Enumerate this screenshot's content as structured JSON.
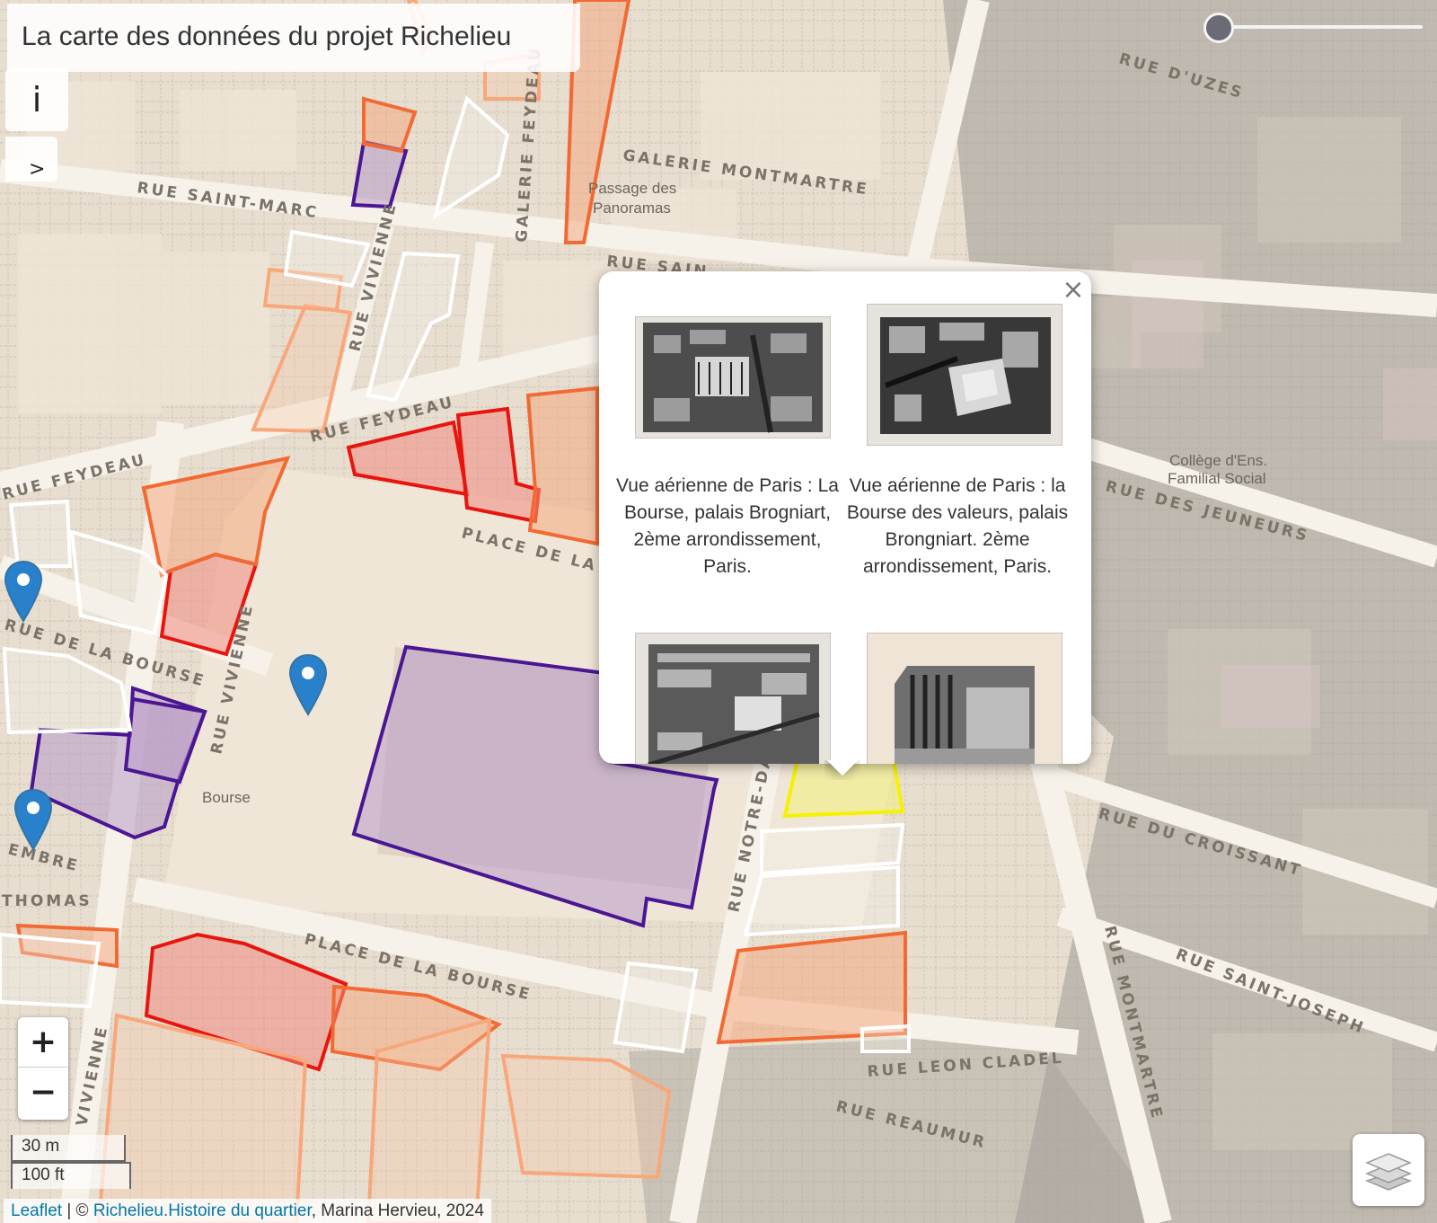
{
  "title": "La carte des données du projet Richelieu",
  "controls": {
    "info_label": "i",
    "expand_label": ">",
    "zoom_in": "+",
    "zoom_out": "−",
    "scale_metric": "30 m",
    "scale_imperial": "100 ft",
    "opacity_slider_level": 0.0
  },
  "map": {
    "streets": [
      "RUE D'UZES",
      "GALERIE MONTMARTRE",
      "RUE SAINT-MARC",
      "GALERIE FEYDEAU",
      "RUE VIVIENNE",
      "RUE SAIN",
      "RUE FEYDEAU",
      "RUE FEYDEAU",
      "PLACE DE LA B",
      "RUE DE LA BOURSE",
      "RUE VIVIENNE",
      "RUE DES JEUNEURS",
      "RUE DU CROISSANT",
      "RUE NOTRE-DA",
      "PLACE DE LA BOURSE",
      "RUE SAINT-JOSEPH",
      "RUE LEON CLADEL",
      "RUE MONTMARTRE",
      "RUE REAUMUR",
      "VIVIENNE",
      "EMBRE",
      "THOMAS"
    ],
    "pois": [
      "Passage des",
      "Panoramas",
      "Collège d'Ens.",
      "Familial Social",
      "Bourse"
    ],
    "colors": {
      "purple": "#5a1a9a",
      "red": "#e8150f",
      "orange": "#f26a33",
      "light_orange": "#f8a77b",
      "yellow": "#ffff00",
      "white": "#ffffff",
      "marker": "#2a81cb"
    }
  },
  "popup": {
    "close_label": "×",
    "items": [
      {
        "caption": "Vue aérienne de Paris : La Bourse, palais Brogniart, 2ème arrondissement, Paris."
      },
      {
        "caption": "Vue aérienne de Paris : la Bourse des valeurs, palais Brongniart. 2ème arrondissement, Paris."
      },
      {
        "caption": ""
      },
      {
        "caption": ""
      }
    ]
  },
  "attribution": {
    "leaflet": "Leaflet",
    "separator": " | © ",
    "link": "Richelieu.Histoire du quartier",
    "rest": ", Marina Hervieu, 2024"
  }
}
